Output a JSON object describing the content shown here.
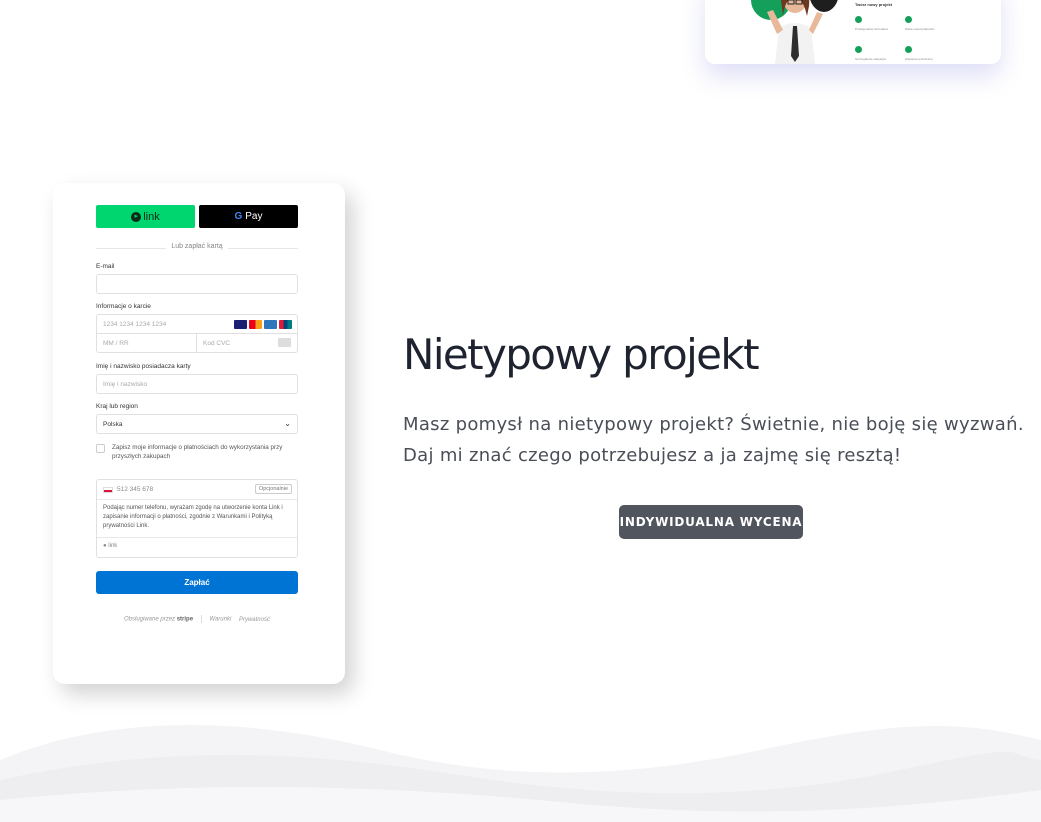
{
  "preview_card": {
    "heading": "Twórz nowy projekt",
    "features": [
      {
        "label": "Profesjonalne formularze"
      },
      {
        "label": "Wiele metod płatności"
      },
      {
        "label": "Szczegółowe statystyki"
      },
      {
        "label": "Wsparcie techniczne"
      }
    ]
  },
  "payment_form": {
    "link_button_label": "link",
    "gpay_button_label": "Pay",
    "divider_text": "Lub zapłać kartą",
    "email_label": "E-mail",
    "email_value": "",
    "card_label": "Informacje o karcie",
    "card_number_placeholder": "1234 1234 1234 1234",
    "expiry_placeholder": "MM / RR",
    "cvc_placeholder": "Kod CVC",
    "name_label": "Imię i nazwisko posiadacza karty",
    "name_placeholder": "Imię i nazwisko",
    "country_label": "Kraj lub region",
    "country_value": "Polska",
    "save_info_text": "Zapisz moje informacje o płatnościach do wykorzystania przy przyszłych zakupach",
    "phone_placeholder": "512 345 678",
    "optional_label": "Opcjonalnie",
    "phone_desc": "Podając numer telefonu, wyrażam zgodę na utworzenie konta Link i zapisanie informacji o płatności, zgodnie z Warunkami i Polityką prywatności Link.",
    "link_footer": "link",
    "pay_button_label": "Zapłać",
    "powered_text": "Obsługiwane przez",
    "powered_brand": "stripe",
    "terms_link": "Warunki",
    "privacy_link": "Prywatność"
  },
  "section": {
    "title": "Nietypowy projekt",
    "description_line1": "Masz pomysł na nietypowy projekt? Świetnie, nie boję się wyzwań.",
    "description_line2": "Daj mi znać czego potrzebujesz a ja zajmę się resztą!",
    "cta_label": "INDYWIDUALNA WYCENA"
  },
  "colors": {
    "link_green": "#00d66f",
    "pay_blue": "#0074d4",
    "cta_bg": "#50555e",
    "heading": "#1f2330"
  }
}
